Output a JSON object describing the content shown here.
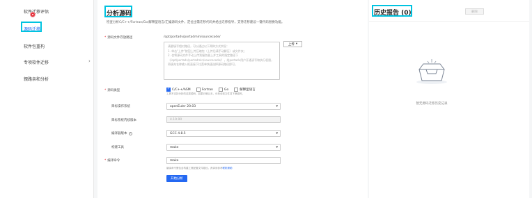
{
  "sidebar": {
    "items": [
      {
        "label": "软件迁移评估"
      },
      {
        "label": "源码迁移"
      },
      {
        "label": "软件包重构"
      },
      {
        "label": "专项软件迁移"
      },
      {
        "label": "親路亲和分析"
      }
    ]
  },
  "main": {
    "title": "分析源码",
    "description": "检查分析C/C++/Fortran/Go/解释型语言/汇编源码文件，定位出需迁移代码并给出迁移指导，支持迁移建议一键代码替换功能。",
    "source_path_label": "源码文件存放路径",
    "source_path_value": "/opt/portadv/portadmin/sourcecode/",
    "textarea_placeholder": "请要填写相对路径，可以通过以下两种方式实现：\n1. 单击\"上传\"按钮上传压缩包（上传后请手动解压）或文件夹；\n2. 也将源码文件手动上传到服务器上并工具的指定路径下（/opt/portadv/portadmin/sourcecode/），给portadv用户开通读写和执行权限，再填充名称输入框直接下拉菜单快速选择源码路径即可。",
    "upload_label": "上传",
    "upload_caret": "▾",
    "source_type_label": "源码类型",
    "source_types": [
      {
        "label": "C/C++/ASM",
        "checked": true
      },
      {
        "label": "Fortran",
        "checked": false
      },
      {
        "label": "Go",
        "checked": false
      },
      {
        "label": "解释型语言",
        "checked": false
      }
    ],
    "source_type_hint": "工具不支持分析的这类源码，如果已确认无，分析全前文件将下满或称。",
    "target_os_label": "目标操作系统",
    "target_os_value": "openEuler 20.03",
    "target_kernel_label": "目标系统内核版本",
    "target_kernel_value": "4.19.90",
    "compiler_label": "编译器版本",
    "compiler_value": "GCC 4.8.5",
    "build_tool_label": "构建工具",
    "build_tool_value": "make",
    "compile_cmd_label": "编译命令",
    "compile_cmd_value": "make",
    "compile_cmd_help": "编译命令需包含构建工具配置文件路径，具体请参考",
    "compile_cmd_help_link": "联机帮助",
    "help_glyph": "?",
    "caret_glyph": "▾",
    "start_label": "开始分析"
  },
  "history": {
    "title": "历史报告 (0)",
    "delete_label": "删除",
    "empty_text": "暂无源码迁移历史记录"
  },
  "colors": {
    "accent": "#2468f2",
    "highlight": "#00c3e0",
    "required": "#e5303a"
  }
}
